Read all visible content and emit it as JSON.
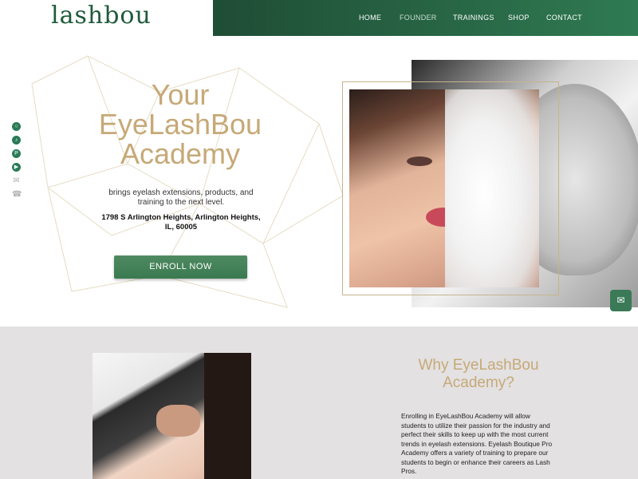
{
  "brand": {
    "logo": "lashbou"
  },
  "nav": {
    "items": [
      {
        "label": "HOME"
      },
      {
        "label": "FOUNDER"
      },
      {
        "label": "TRAININGS"
      },
      {
        "label": "SHOP"
      },
      {
        "label": "CONTACT"
      }
    ],
    "active": "FOUNDER"
  },
  "hero": {
    "title_line1": "Your",
    "title_line2": "EyeLashBou",
    "title_line3": "Academy",
    "subtitle": "brings eyelash extensions, products, and training to the next level.",
    "address": "1798 S Arlington Heights, Arlington Heights, IL, 60005",
    "cta_label": "ENROLL NOW"
  },
  "social": [
    "instagram-icon",
    "tiktok-icon",
    "pinterest-icon",
    "youtube-icon",
    "mail-icon",
    "phone-icon"
  ],
  "why": {
    "title": "Why EyeLashBou Academy?",
    "body": "Enrolling in EyeLashBou Academy will allow students to utilize their passion for the industry and perfect their skills to keep up with the most current trends in eyelash extensions. Eyelash Boutique Pro Academy offers a variety of training to prepare our students to begin or enhance their careers as Lash Pros."
  },
  "colors": {
    "brand_green": "#1f5a3a",
    "gold": "#c6a977",
    "section_gray": "#e3e1e2"
  }
}
